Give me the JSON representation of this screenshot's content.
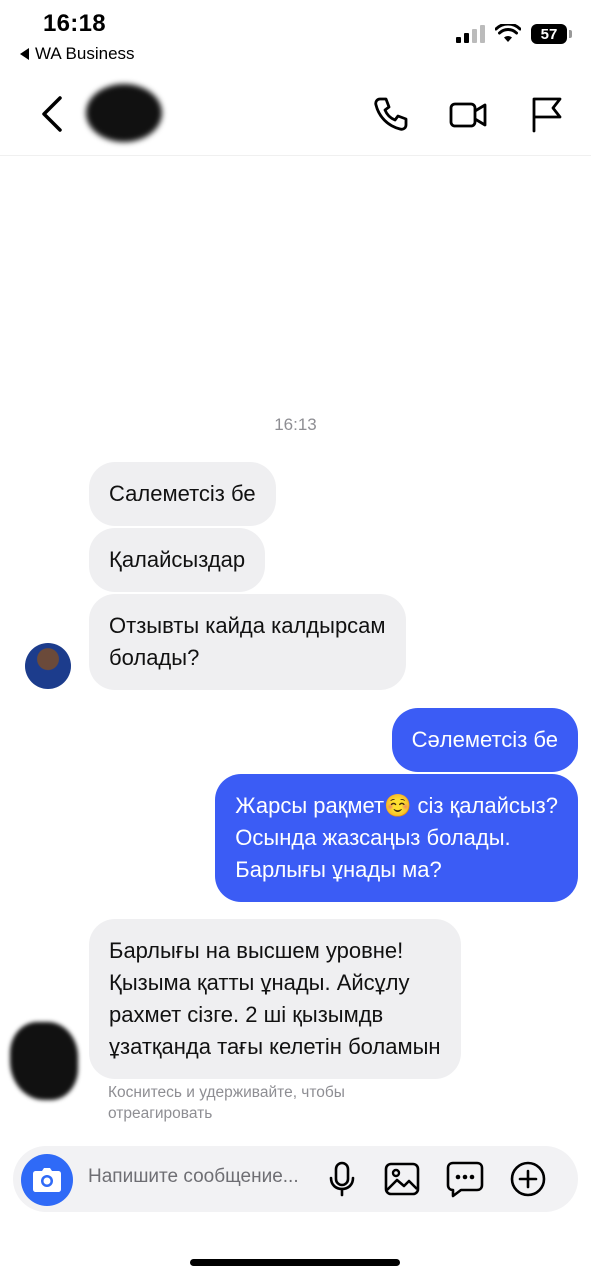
{
  "status_bar": {
    "time": "16:18",
    "back_app": "WA Business",
    "battery": "57"
  },
  "header": {
    "contact_name": "",
    "icons": [
      "chevron-left-icon",
      "phone-icon",
      "video-icon",
      "flag-icon"
    ]
  },
  "chat": {
    "timestamp": "16:13",
    "messages": [
      {
        "direction": "in",
        "text": "Салеметсіз бе"
      },
      {
        "direction": "in",
        "text": "Қалайсыздар"
      },
      {
        "direction": "in",
        "text": "Отзывты кайда калдырсам\nболады?"
      },
      {
        "direction": "out",
        "text": "Сәлеметсіз бе"
      },
      {
        "direction": "out",
        "text": "Жарсы рақмет☺️ сіз қалайсыз?\nОсында жазсаңыз болады.\nБарлығы ұнады ма?"
      },
      {
        "direction": "in",
        "text": "Барлығы на высшем уровне!\nҚызыма қатты ұнады. Айсұлу\nрахмет сізге. 2 ші қызымдв\nұзатқанда тағы келетін боламын"
      }
    ],
    "reaction_hint": "Коснитесь и удерживайте, чтобы\nотреагировать"
  },
  "composer": {
    "placeholder": "Напишите сообщение...",
    "icons": [
      "camera-icon",
      "microphone-icon",
      "image-icon",
      "sticker-icon",
      "plus-icon"
    ]
  },
  "colors": {
    "outgoing_bubble": "#3b5cf5",
    "incoming_bubble": "#efeff1",
    "camera_button": "#2f6af7"
  }
}
